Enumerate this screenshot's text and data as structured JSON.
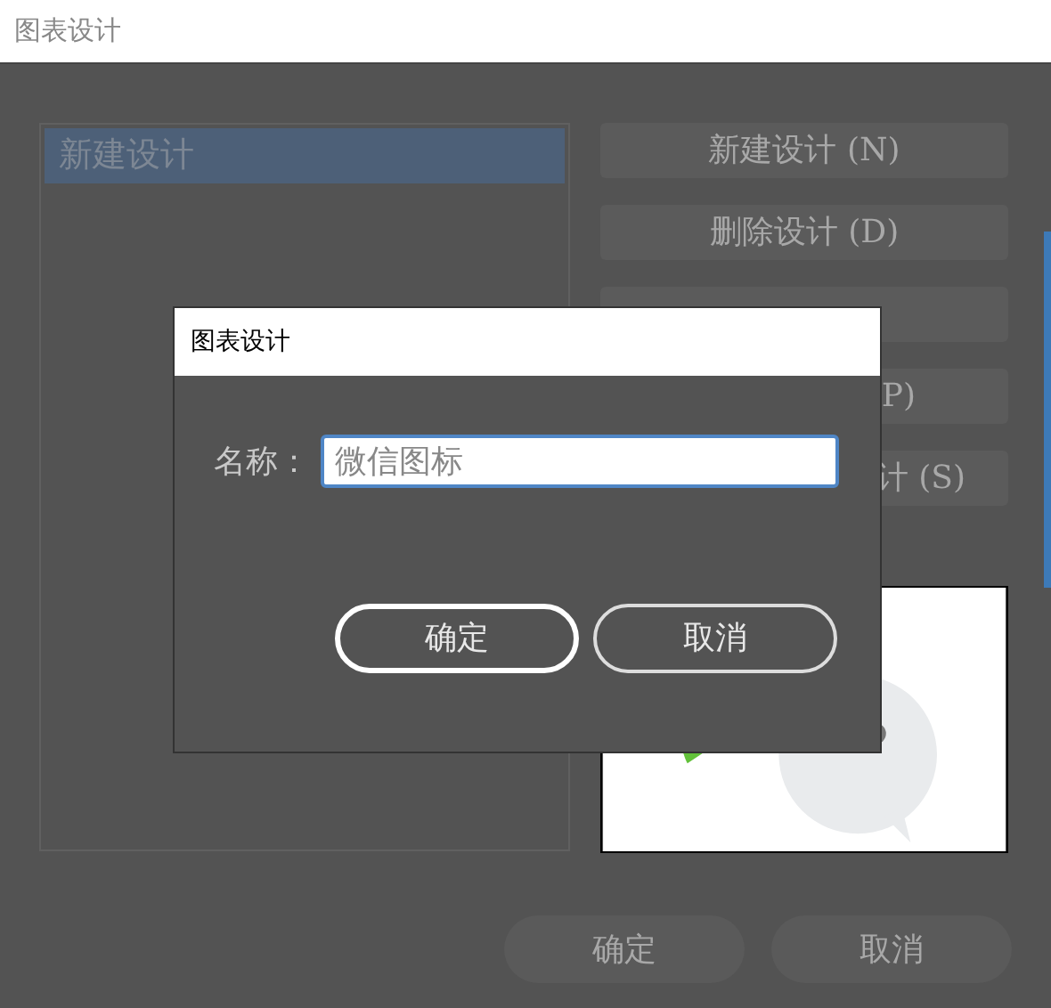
{
  "window": {
    "title": "图表设计"
  },
  "design_list": {
    "items": [
      {
        "label": "新建设计",
        "selected": true
      }
    ]
  },
  "side_buttons": [
    {
      "kind": "full",
      "label": "新建设计 (N)"
    },
    {
      "kind": "full",
      "label": "删除设计 (D)"
    },
    {
      "kind": "hidden"
    },
    {
      "kind": "cut",
      "label": "P)"
    },
    {
      "kind": "tail",
      "label": "计 (S)"
    }
  ],
  "footer_buttons": [
    "确定",
    "取消"
  ],
  "dialog": {
    "title": "图表设计",
    "name_label": "名称：",
    "name_value": "微信图标",
    "buttons": [
      {
        "label": "确定",
        "default": true
      },
      {
        "label": "取消",
        "default": false
      }
    ]
  }
}
